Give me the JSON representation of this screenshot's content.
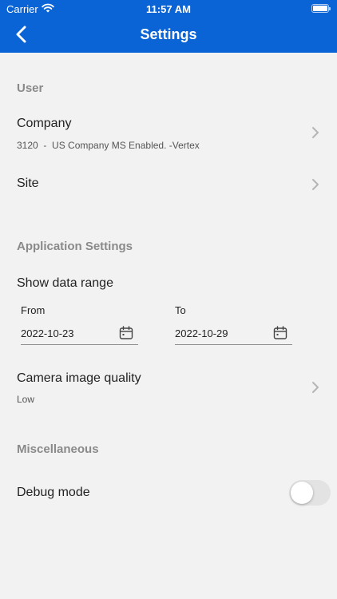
{
  "status_bar": {
    "carrier": "Carrier",
    "time": "11:57 AM"
  },
  "nav": {
    "title": "Settings",
    "back_icon": "chevron-left-icon"
  },
  "colors": {
    "accent": "#0a64d6",
    "background": "#f2f2f2",
    "section": "#8a8a8a"
  },
  "user": {
    "header": "User",
    "company": {
      "label": "Company",
      "value": "3120  -  US Company MS Enabled. -Vertex"
    },
    "site": {
      "label": "Site"
    }
  },
  "app_settings": {
    "header": "Application Settings",
    "data_range": {
      "label": "Show data range",
      "from_label": "From",
      "from_value": "2022-10-23",
      "to_label": "To",
      "to_value": "2022-10-29"
    },
    "camera": {
      "label": "Camera image quality",
      "value": "Low"
    }
  },
  "misc": {
    "header": "Miscellaneous",
    "debug": {
      "label": "Debug mode",
      "enabled": false
    }
  }
}
